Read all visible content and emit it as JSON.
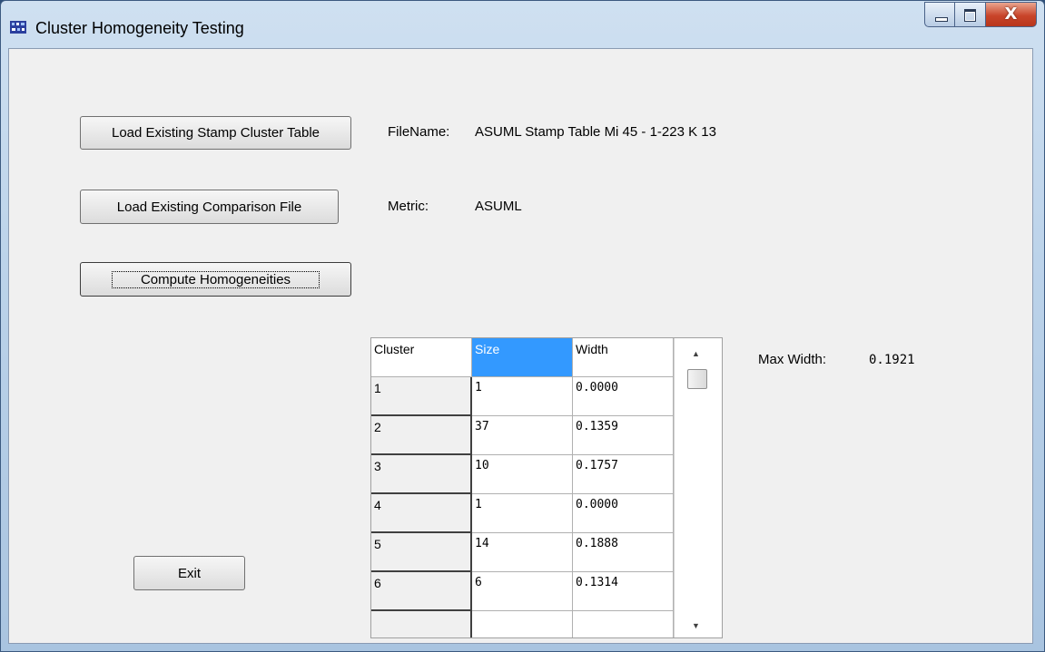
{
  "window": {
    "title": "Cluster Homogeneity Testing",
    "close_glyph": "X"
  },
  "buttons": {
    "load_stamp": "Load Existing Stamp Cluster Table",
    "load_comparison": "Load Existing Comparison File",
    "compute": "Compute Homogeneities",
    "exit": "Exit"
  },
  "info": {
    "filename_label": "FileName:",
    "filename_value": "ASUML Stamp Table Mi 45 - 1-223 K 13",
    "metric_label": "Metric:",
    "metric_value": "ASUML",
    "max_width_label": "Max Width:",
    "max_width_value": "0.1921"
  },
  "table": {
    "headers": [
      "Cluster",
      "Size",
      "Width"
    ],
    "rows": [
      [
        "1",
        "1",
        "0.0000"
      ],
      [
        "2",
        "37",
        "0.1359"
      ],
      [
        "3",
        "10",
        "0.1757"
      ],
      [
        "4",
        "1",
        "0.0000"
      ],
      [
        "5",
        "14",
        "0.1888"
      ],
      [
        "6",
        "6",
        "0.1314"
      ]
    ]
  },
  "colors": {
    "selected_header": "#3399ff",
    "close_button": "#c9452a"
  }
}
